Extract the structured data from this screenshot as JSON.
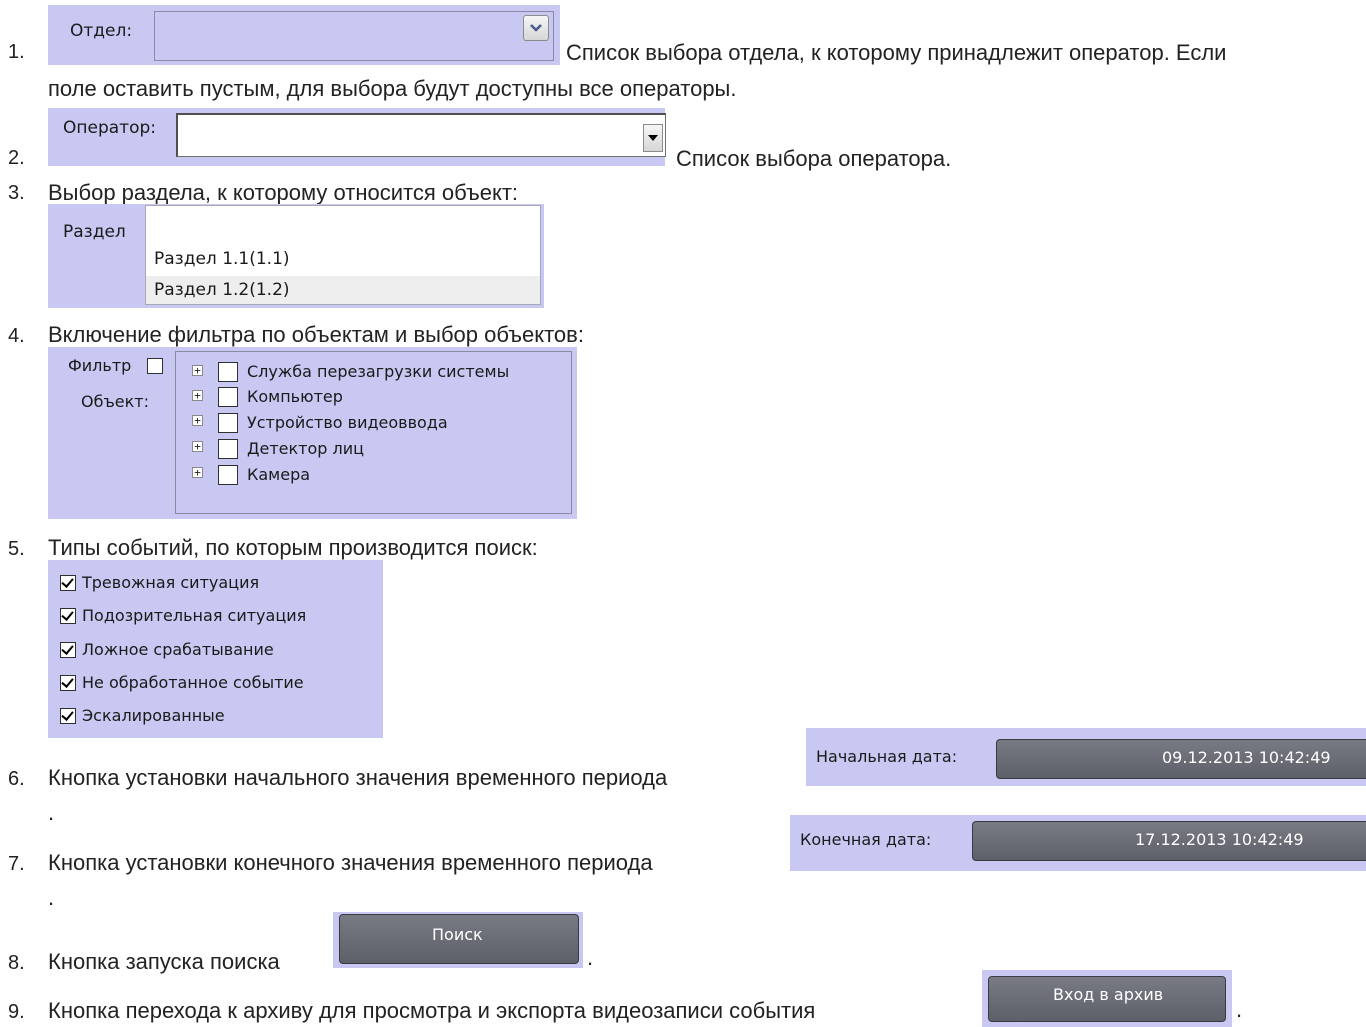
{
  "items": [
    {
      "num": "1.",
      "label": "Отдел:",
      "desc1": "Список выбора отдела, к которому принадлежит оператор. Если",
      "desc2": "поле оставить пустым, для выбора будут доступны все операторы."
    },
    {
      "num": "2.",
      "label": "Оператор:",
      "desc": "Список выбора оператора."
    },
    {
      "num": "3.",
      "desc": "Выбор раздела, к которому относится объект:",
      "label": "Раздел",
      "options": [
        "Раздел 1.1(1.1)",
        "Раздел 1.2(1.2)"
      ]
    },
    {
      "num": "4.",
      "desc": "Включение фильтра по объектам и выбор объектов:",
      "filter_label": "Фильтр",
      "object_label": "Объект:",
      "tree": [
        "Служба перезагрузки системы",
        "Компьютер",
        "Устройство видеоввода",
        "Детектор лиц",
        "Камера"
      ]
    },
    {
      "num": "5.",
      "desc": "Типы событий, по которым производится поиск:",
      "events": [
        "Тревожная ситуация",
        "Подозрительная ситуация",
        "Ложное срабатывание",
        "Не обработанное событие",
        "Эскалированные"
      ]
    },
    {
      "num": "6.",
      "desc": "Кнопка установки начального значения временного периода",
      "label": "Начальная дата:",
      "value": "09.12.2013 10:42:49",
      "tail": "."
    },
    {
      "num": "7.",
      "desc": "Кнопка установки конечного значения временного периода",
      "label": "Конечная дата:",
      "value": "17.12.2013 10:42:49",
      "tail": "."
    },
    {
      "num": "8.",
      "desc": "Кнопка запуска поиска",
      "button": "Поиск",
      "tail": "."
    },
    {
      "num": "9.",
      "desc": "Кнопка перехода к архиву для просмотра и экспорта видеозаписи события",
      "button": "Вход в архив",
      "tail": "."
    }
  ],
  "colors": {
    "panel": "#c8c8f2",
    "dark_button": "#6a6c75",
    "text": "#222222"
  }
}
